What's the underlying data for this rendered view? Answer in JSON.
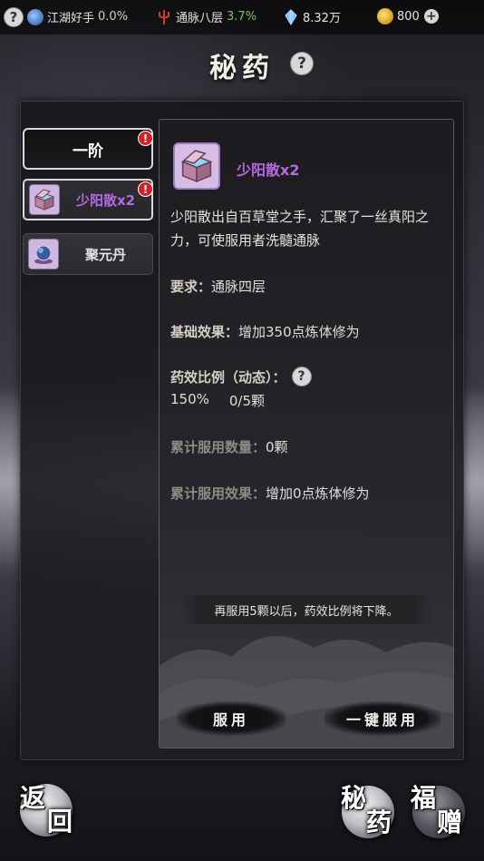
{
  "topbar": {
    "help": "?",
    "rank_name": "江湖好手",
    "rank_pct": "0.0%",
    "realm_name": "通脉八层",
    "realm_pct": "3.7%",
    "crystals": "8.32万",
    "coins": "800",
    "add": "+"
  },
  "title": "秘药",
  "title_help": "?",
  "tier": {
    "label": "一阶",
    "alert": "!"
  },
  "items": [
    {
      "label": "少阳散x2",
      "alert": "!",
      "selected": true
    },
    {
      "label": "聚元丹",
      "selected": false
    }
  ],
  "detail": {
    "name": "少阳散x2",
    "description": "少阳散出自百草堂之手，汇聚了一丝真阳之力，可使服用者洗髓通脉",
    "requirement_label": "要求：",
    "requirement_value": "通脉四层",
    "base_effect_label": "基础效果：",
    "base_effect_value": "增加350点炼体修为",
    "ratio_label": "药效比例（动态）：",
    "ratio_help": "?",
    "ratio_percent": "150%",
    "ratio_count": "0/5颗",
    "total_count_label": "累计服用数量：",
    "total_count_value": "0颗",
    "total_effect_label": "累计服用效果：",
    "total_effect_value": "增加0点炼体修为",
    "notice": "再服用5颗以后，药效比例将下降。",
    "take_button": "服用",
    "take_all_button": "一键服用"
  },
  "bottom": {
    "back_top": "返",
    "back_bottom": "回",
    "elixir_top": "秘",
    "elixir_bottom": "药",
    "gift_top": "福",
    "gift_bottom": "赠"
  },
  "colors": {
    "accent_purple": "#b46ae0",
    "alert_red": "#d3202a",
    "realm_green": "#7fc36a"
  },
  "icons": [
    "help-icon",
    "yinyang-icon",
    "trident-icon",
    "crystal-icon",
    "coin-icon",
    "plus-icon",
    "chest-icon",
    "orb-icon"
  ]
}
